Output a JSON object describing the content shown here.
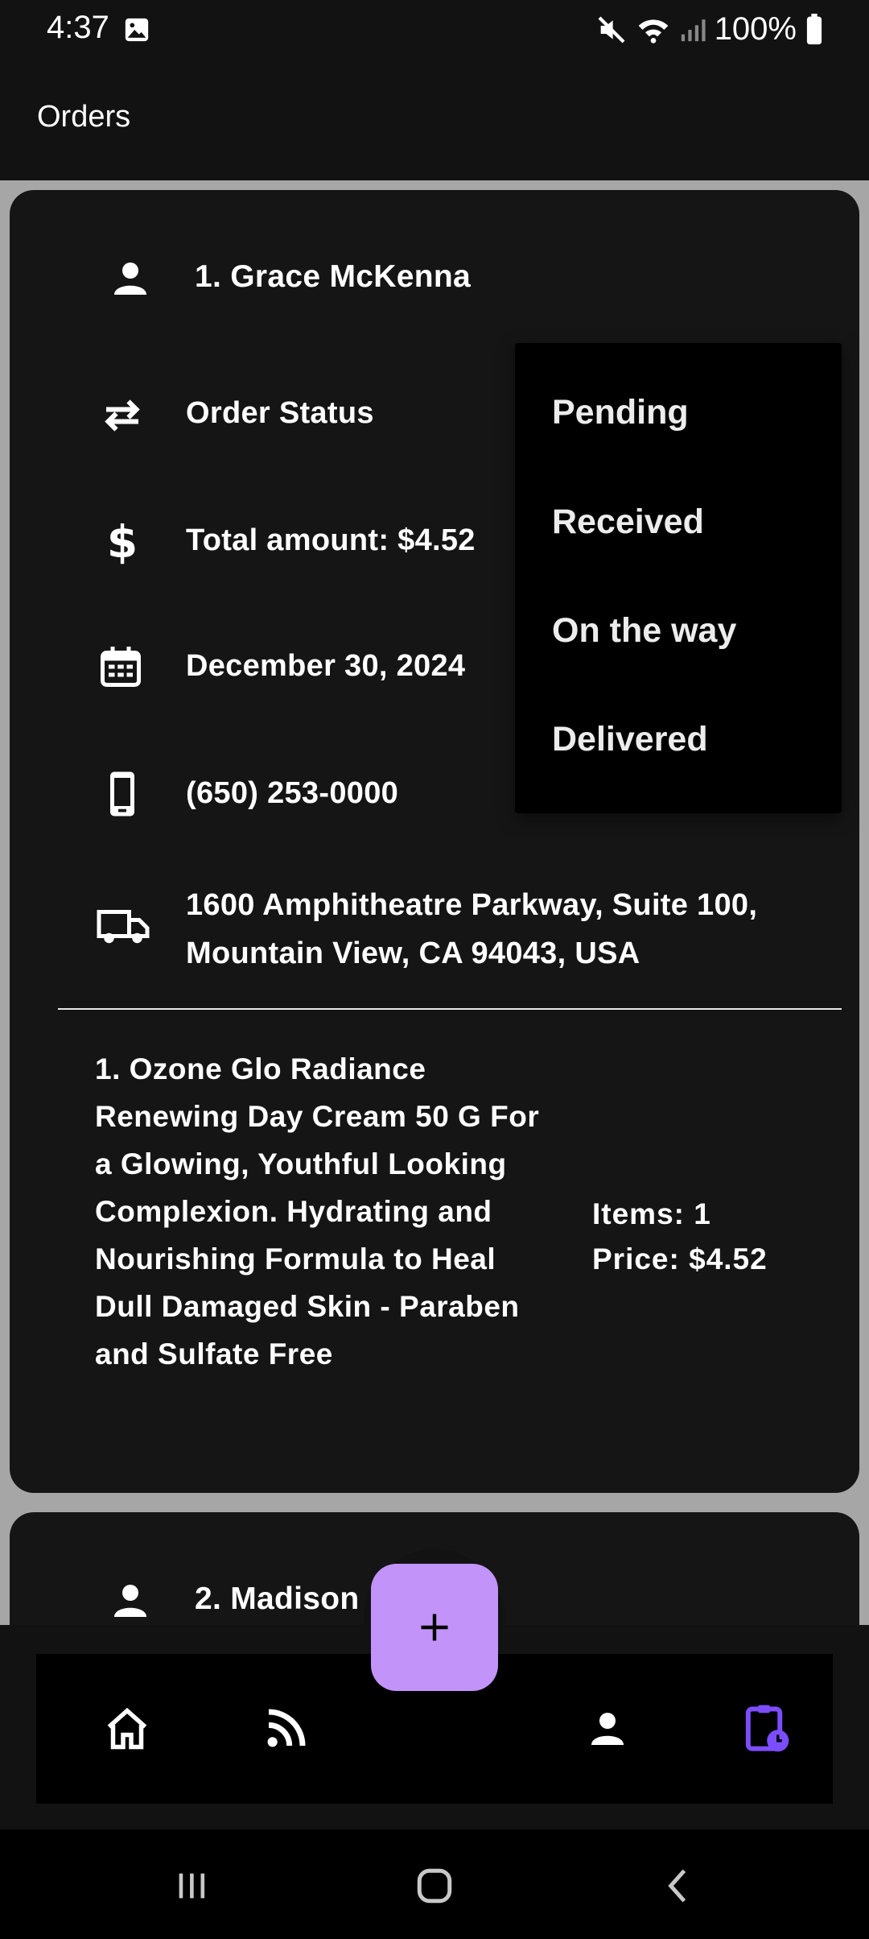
{
  "status_bar": {
    "time": "4:37",
    "battery": "100%"
  },
  "app_bar": {
    "title": "Orders"
  },
  "orders": [
    {
      "customer": "1. Grace McKenna",
      "status_label": "Order Status",
      "total": "Total amount: $4.52",
      "date": "December 30, 2024",
      "phone": "(650) 253-0000",
      "address_line1": "1600 Amphitheatre Parkway, Suite 100,",
      "address_line2": "Mountain View, CA 94043, USA",
      "product": "1. Ozone Glo Radiance Renewing Day Cream 50 G For a Glowing, Youthful Looking Complexion. Hydrating and Nourishing Formula to Heal Dull Damaged Skin - Paraben and Sulfate Free",
      "items": "Items: 1",
      "price": "Price: $4.52"
    },
    {
      "customer": "2. Madison"
    }
  ],
  "status_dropdown": {
    "options": [
      "Pending",
      "Received",
      "On the way",
      "Delivered"
    ]
  },
  "bottom_nav": {
    "icons": [
      "home-icon",
      "feed-icon",
      "profile-icon",
      "orders-icon"
    ],
    "active": "orders-icon",
    "active_color": "#7c4dff",
    "fab_color": "#c293f8"
  }
}
